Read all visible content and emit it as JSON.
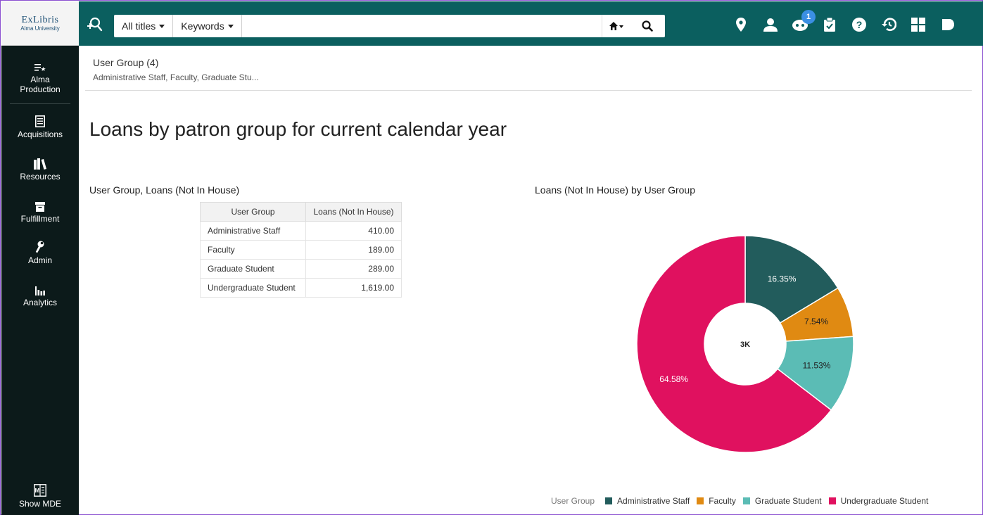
{
  "app": {
    "logo_line1": "ExLibris",
    "logo_line2": "Alma University"
  },
  "search": {
    "scope": "All titles",
    "field": "Keywords",
    "value": ""
  },
  "notifications": {
    "badge": "1"
  },
  "sidebar": {
    "items": [
      {
        "label": "Alma Production",
        "icon": "list-star-icon"
      },
      {
        "label": "Acquisitions",
        "icon": "ledger-icon"
      },
      {
        "label": "Resources",
        "icon": "books-icon"
      },
      {
        "label": "Fulfillment",
        "icon": "inbox-icon"
      },
      {
        "label": "Admin",
        "icon": "wrench-icon"
      },
      {
        "label": "Analytics",
        "icon": "bar-chart-icon"
      }
    ],
    "bottom": {
      "label": "Show MDE",
      "icon": "mde-icon"
    }
  },
  "filter": {
    "label": "User Group (4)",
    "values": "Administrative Staff, Faculty, Graduate Stu..."
  },
  "page": {
    "title": "Loans by patron group for current calendar year"
  },
  "table": {
    "title": "User Group, Loans (Not In House)",
    "headers": [
      "User Group",
      "Loans (Not In House)"
    ],
    "rows": [
      [
        "Administrative Staff",
        "410.00"
      ],
      [
        "Faculty",
        "189.00"
      ],
      [
        "Graduate Student",
        "289.00"
      ],
      [
        "Undergraduate Student",
        "1,619.00"
      ]
    ]
  },
  "chart_data": {
    "type": "pie",
    "title": "Loans (Not In House) by User Group",
    "center_label": "3K",
    "legend_title": "User Group",
    "legend_position": "bottom",
    "slices": [
      {
        "name": "Administrative Staff",
        "value": 410,
        "percent_label": "16.35%",
        "color": "#225c5c"
      },
      {
        "name": "Faculty",
        "value": 189,
        "percent_label": "7.54%",
        "color": "#e08a12"
      },
      {
        "name": "Graduate Student",
        "value": 289,
        "percent_label": "11.53%",
        "color": "#5bbcb5"
      },
      {
        "name": "Undergraduate Student",
        "value": 1619,
        "percent_label": "64.58%",
        "color": "#e0115f"
      }
    ]
  },
  "colors": {
    "topbar": "#0b5f5f",
    "sidebar": "#0c1a1a"
  }
}
